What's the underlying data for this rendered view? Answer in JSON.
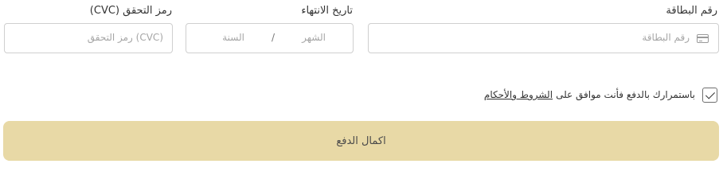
{
  "card_number": {
    "label": "رقم البطاقة",
    "placeholder": "رقم البطاقة",
    "icon": "credit-card-icon"
  },
  "expiry": {
    "label": "تاريخ الانتهاء",
    "month_placeholder": "الشهر",
    "separator": "/",
    "year_placeholder": "السنة"
  },
  "cvc": {
    "label": "رمز التحقق (CVC)",
    "placeholder": "(CVC) رمز التحقق"
  },
  "terms": {
    "checked": true,
    "text": "باستمرارك بالدفع فأنت موافق على",
    "link": "الشروط والأحكام"
  },
  "submit": {
    "label": "اكمال الدفع",
    "color": "#e8d9a6"
  }
}
